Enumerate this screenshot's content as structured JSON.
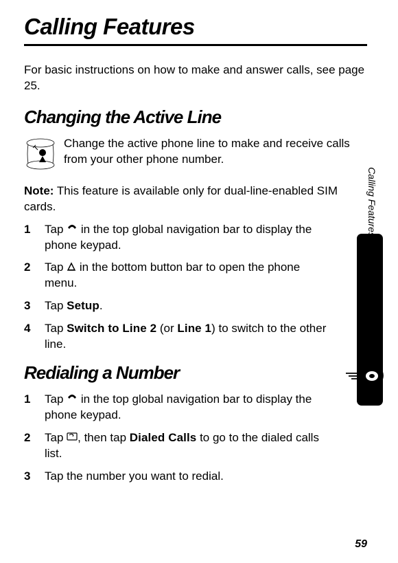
{
  "pageTitle": "Calling Features",
  "intro": "For basic instructions on how to make and answer calls, see page 25.",
  "section1": {
    "heading": "Changing the Active Line",
    "paragraph": "Change the active phone line to make and receive calls from your other phone number.",
    "noteLabel": "Note:",
    "noteText": " This feature is available only for dual-line-enabled SIM cards.",
    "steps": {
      "s1a": "Tap ",
      "s1b": " in the top global navigation bar to display the phone keypad.",
      "s2a": "Tap ",
      "s2b": " in the bottom button bar to open the phone menu.",
      "s3a": "Tap ",
      "s3label": "Setup",
      "s3b": ".",
      "s4a": "Tap ",
      "s4label1": "Switch to Line 2",
      "s4mid": " (or ",
      "s4label2": "Line 1",
      "s4b": ") to switch to the other line."
    }
  },
  "section2": {
    "heading": "Redialing a Number",
    "steps": {
      "s1a": "Tap ",
      "s1b": " in the top global navigation bar to display the phone keypad.",
      "s2a": "Tap ",
      "s2b": ", then tap ",
      "s2label": "Dialed Calls",
      "s2c": " to go to the dialed calls list.",
      "s3": "Tap the number you want to redial."
    }
  },
  "sideTabText": "Calling Features",
  "pageNumber": "59"
}
